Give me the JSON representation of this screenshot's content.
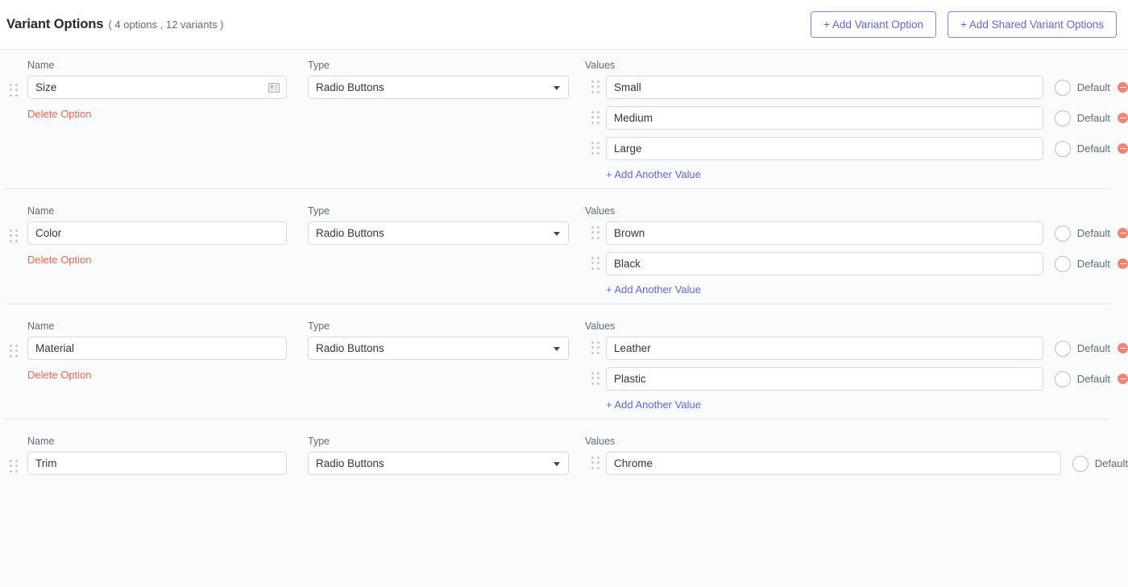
{
  "header": {
    "title": "Variant Options",
    "subtitle": "( 4 options , 12 variants )",
    "add_variant_option_label": "+ Add Variant Option",
    "add_shared_variant_options_label": "+ Add Shared Variant Options"
  },
  "labels": {
    "name": "Name",
    "type": "Type",
    "values": "Values",
    "delete_option": "Delete Option",
    "add_another_value": "+ Add Another Value",
    "default": "Default"
  },
  "colors": {
    "link_blue": "#5b69e3",
    "danger_coral": "#f4674f",
    "minus_icon": "#f4826e",
    "page_bg": "#fafbfc",
    "border": "#d7dbe0"
  },
  "options": [
    {
      "name": "Size",
      "type": "Radio Buttons",
      "has_card_icon": true,
      "show_delete_option": true,
      "show_add_value": true,
      "values": [
        {
          "value": "Small",
          "default_label": "Default",
          "show_delete": true
        },
        {
          "value": "Medium",
          "default_label": "Default",
          "show_delete": true
        },
        {
          "value": "Large",
          "default_label": "Default",
          "show_delete": true
        }
      ]
    },
    {
      "name": "Color",
      "type": "Radio Buttons",
      "has_card_icon": false,
      "show_delete_option": true,
      "show_add_value": true,
      "values": [
        {
          "value": "Brown",
          "default_label": "Default",
          "show_delete": true
        },
        {
          "value": "Black",
          "default_label": "Default",
          "show_delete": true
        }
      ]
    },
    {
      "name": "Material",
      "type": "Radio Buttons",
      "has_card_icon": false,
      "show_delete_option": true,
      "show_add_value": true,
      "values": [
        {
          "value": "Leather",
          "default_label": "Default",
          "show_delete": true
        },
        {
          "value": "Plastic",
          "default_label": "Default",
          "show_delete": true
        }
      ]
    },
    {
      "name": "Trim",
      "type": "Radio Buttons",
      "has_card_icon": false,
      "show_delete_option": false,
      "show_add_value": false,
      "values": [
        {
          "value": "Chrome",
          "default_label": "Default",
          "show_delete": false
        }
      ]
    }
  ]
}
